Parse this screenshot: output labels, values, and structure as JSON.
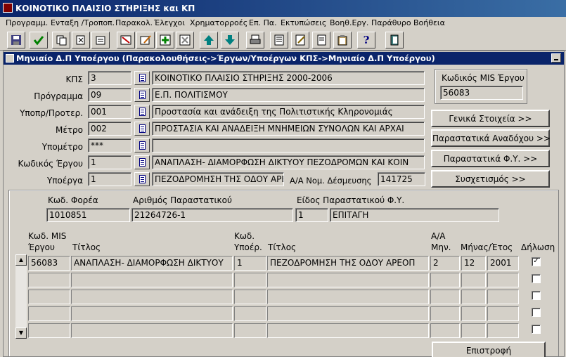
{
  "app": {
    "title": "ΚΟΙΝΟΤΙΚΟ ΠΛΑΙΣΙΟ ΣΤΗΡΙΞΗΣ και ΚΠ"
  },
  "menu": [
    "Προγραμμ.",
    "Ενταξη /Τροποπ.",
    "Παρακολ.",
    "Έλεγχοι",
    "Χρηματορροές",
    "Επ. Πα.",
    "Εκτυπώσεις",
    "Βοηθ.Εργ.",
    "Παράθυρο",
    "Βοήθεια"
  ],
  "toolbar": {
    "icons": [
      "save-icon",
      "accept-icon",
      "copy-icon",
      "clear-icon",
      "duplicate-icon",
      "filter-icon",
      "edit-icon",
      "insert-row-icon",
      "delete-row-icon",
      "arrow-up-icon",
      "arrow-down-icon",
      "print-icon",
      "list-icon",
      "edit-list-icon",
      "document-icon",
      "clipboard-icon",
      "help-icon",
      "exit-icon"
    ],
    "help_glyph": "?"
  },
  "window": {
    "title": "Μηνιαίο Δ.Π Υποέργου (Παρακολουθήσεις->Έργων/Υποέργων ΚΠΣ->Μηνιαίο Δ.Π Υποέργου)"
  },
  "form": {
    "kps": {
      "label": "ΚΠΣ",
      "code": "3",
      "desc": "ΚΟΙΝΟΤΙΚΟ ΠΛΑΙΣΙΟ ΣΤΗΡΙΞΗΣ 2000-2006"
    },
    "programma": {
      "label": "Πρόγραμμα",
      "code": "09",
      "desc": "Ε.Π. ΠΟΛΙΤΙΣΜΟΥ"
    },
    "ypopr": {
      "label": "Υποπρ/Προτερ.",
      "code": "001",
      "desc": "Προστασία και ανάδειξη της Πολιτιστικής Κληρονομιάς"
    },
    "metro": {
      "label": "Μέτρο",
      "code": "002",
      "desc": "ΠΡΟΣΤΑΣΙΑ ΚΑΙ ΑΝΑΔΕΙΞΗ ΜΝΗΜΕΙΩΝ ΣΥΝΟΛΩΝ ΚΑΙ ΑΡΧΑΙ"
    },
    "ypometro": {
      "label": "Υπομέτρο",
      "code": "***",
      "desc": ""
    },
    "kodikos_ergou": {
      "label": "Κωδικός Έργου",
      "code": "1",
      "desc": "ΑΝΑΠΛΑΣΗ- ΔΙΑΜΟΡΦΩΣΗ ΔΙΚΤΥΟΥ ΠΕΖΟΔΡΟΜΩΝ ΚΑΙ ΚΟΙΝ"
    },
    "ypoerga": {
      "label": "Υποέργα",
      "code": "1",
      "desc": "ΠΕΖΟΔΡΟΜΗΣΗ ΤΗΣ ΟΔΟΥ ΑΡΕΟΠ",
      "aa_label": "Α/Α Νομ. Δέσμευσης",
      "aa_value": "141725"
    },
    "mis": {
      "label": "Κωδικός MIS Έργου",
      "value": "56083"
    }
  },
  "buttons": {
    "genika": "Γενικά Στοιχεία >>",
    "anadoxou": "Παραστατικά Αναδόχου >>",
    "fy": "Παραστατικά Φ.Υ. >>",
    "syschetismos": "Συσχετισμός >>",
    "epistrofi": "Επιστροφή"
  },
  "parastatiko": {
    "foreas_label": "Κωδ. Φορέα",
    "foreas_value": "1010851",
    "arithmos_label": "Αριθμός Παραστατικού",
    "arithmos_value": "21264726-1",
    "eidos_label": "Είδος Παραστατικού Φ.Υ.",
    "eidos_code": "1",
    "eidos_desc": "ΕΠΙΤΑΓΗ"
  },
  "grid": {
    "headers": {
      "mis_line1": "Κωδ. MIS",
      "mis_line2": "Έργου",
      "titlos": "Τίτλος",
      "ypoer_line1": "Κωδ.",
      "ypoer_line2": "Υποέρ.",
      "titlos2": "Τίτλος",
      "aa_line1": "Α/Α",
      "aa_line2": "Μην.",
      "minas_etos": "Μήνας/Έτος",
      "dilosi": "Δήλωση"
    },
    "rows": [
      {
        "mis": "56083",
        "titlos": "ΑΝΑΠΛΑΣΗ- ΔΙΑΜΟΡΦΩΣΗ ΔΙΚΤΥΟΥ",
        "ypoer": "1",
        "titlos2": "ΠΕΖΟΔΡΟΜΗΣΗ ΤΗΣ ΟΔΟΥ ΑΡΕΟΠ",
        "aa": "2",
        "minas": "12",
        "etos": "2001",
        "checked": true
      },
      {
        "mis": "",
        "titlos": "",
        "ypoer": "",
        "titlos2": "",
        "aa": "",
        "minas": "",
        "etos": "",
        "checked": false
      },
      {
        "mis": "",
        "titlos": "",
        "ypoer": "",
        "titlos2": "",
        "aa": "",
        "minas": "",
        "etos": "",
        "checked": false
      },
      {
        "mis": "",
        "titlos": "",
        "ypoer": "",
        "titlos2": "",
        "aa": "",
        "minas": "",
        "etos": "",
        "checked": false
      },
      {
        "mis": "",
        "titlos": "",
        "ypoer": "",
        "titlos2": "",
        "aa": "",
        "minas": "",
        "etos": "",
        "checked": false
      }
    ],
    "check_glyph": "✓",
    "scroll_up_glyph": "▲",
    "scroll_down_glyph": "▼"
  }
}
